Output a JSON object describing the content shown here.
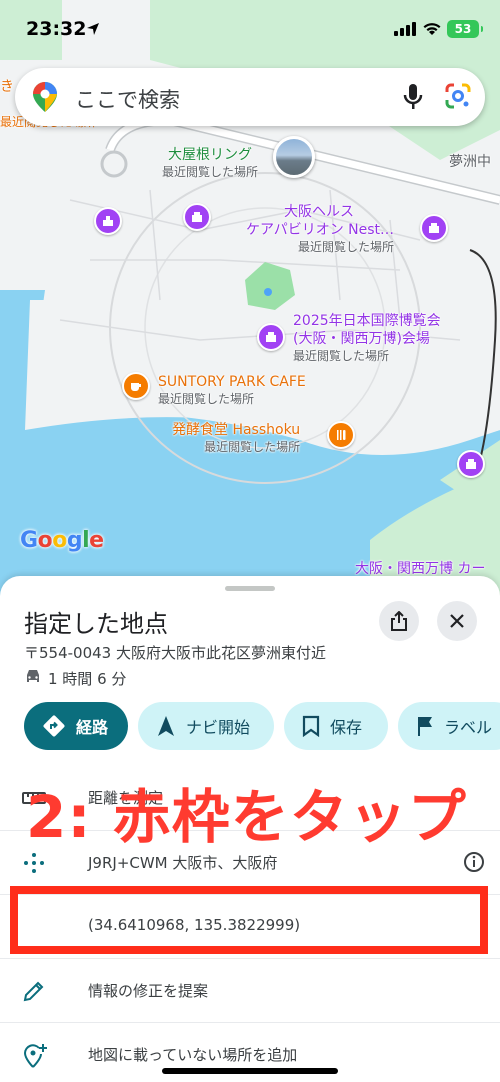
{
  "status_bar": {
    "time": "23:32",
    "battery": "53"
  },
  "search": {
    "placeholder": "ここで検索"
  },
  "map": {
    "edge_labels": {
      "top_left_1": "き",
      "top_left_2": "最近閲覧した場所",
      "top_right": "夢洲中"
    },
    "pois": [
      {
        "name": "大屋根リング",
        "sub": "最近閲覧した場所",
        "color": "#1e8e3e"
      },
      {
        "name": "大阪ヘルス",
        "name2": "ケアパビリオン Nest…",
        "sub": "最近閲覧した場所",
        "color": "#9334e6"
      },
      {
        "name": "2025年日本国際博覧会",
        "name2": "(大阪・関西万博)会場",
        "sub": "最近閲覧した場所",
        "color": "#9334e6"
      },
      {
        "name": "SUNTORY PARK CAFE",
        "sub": "最近閲覧した場所",
        "color": "#e8710a"
      },
      {
        "name": "発酵食堂 Hasshoku",
        "sub": "最近閲覧した場所",
        "color": "#e8710a"
      },
      {
        "name": "大阪・関西万博 カー",
        "color": "#9334e6"
      }
    ],
    "logo": "Google"
  },
  "sheet": {
    "title": "指定した地点",
    "address": "〒554-0043 大阪府大阪市此花区夢洲東付近",
    "drive_time": "1 時間 6 分",
    "chips": [
      {
        "label": "経路",
        "icon": "directions-icon"
      },
      {
        "label": "ナビ開始",
        "icon": "navigation-arrow-icon"
      },
      {
        "label": "保存",
        "icon": "bookmark-icon"
      },
      {
        "label": "ラベル",
        "icon": "label-flag-icon"
      }
    ],
    "rows": [
      {
        "text": "距離を測定",
        "icon": "ruler-icon"
      },
      {
        "text": "J9RJ+CWM 大阪市、大阪府",
        "icon": "plus-code-icon"
      },
      {
        "text": "(34.6410968, 135.3822999)",
        "icon": ""
      },
      {
        "text": "情報の修正を提案",
        "icon": "pencil-icon"
      },
      {
        "text": "地図に載っていない場所を追加",
        "icon": "add-place-icon"
      }
    ]
  },
  "annotation": {
    "text": "2: 赤枠をタップ",
    "color": "#ff2d1a"
  }
}
